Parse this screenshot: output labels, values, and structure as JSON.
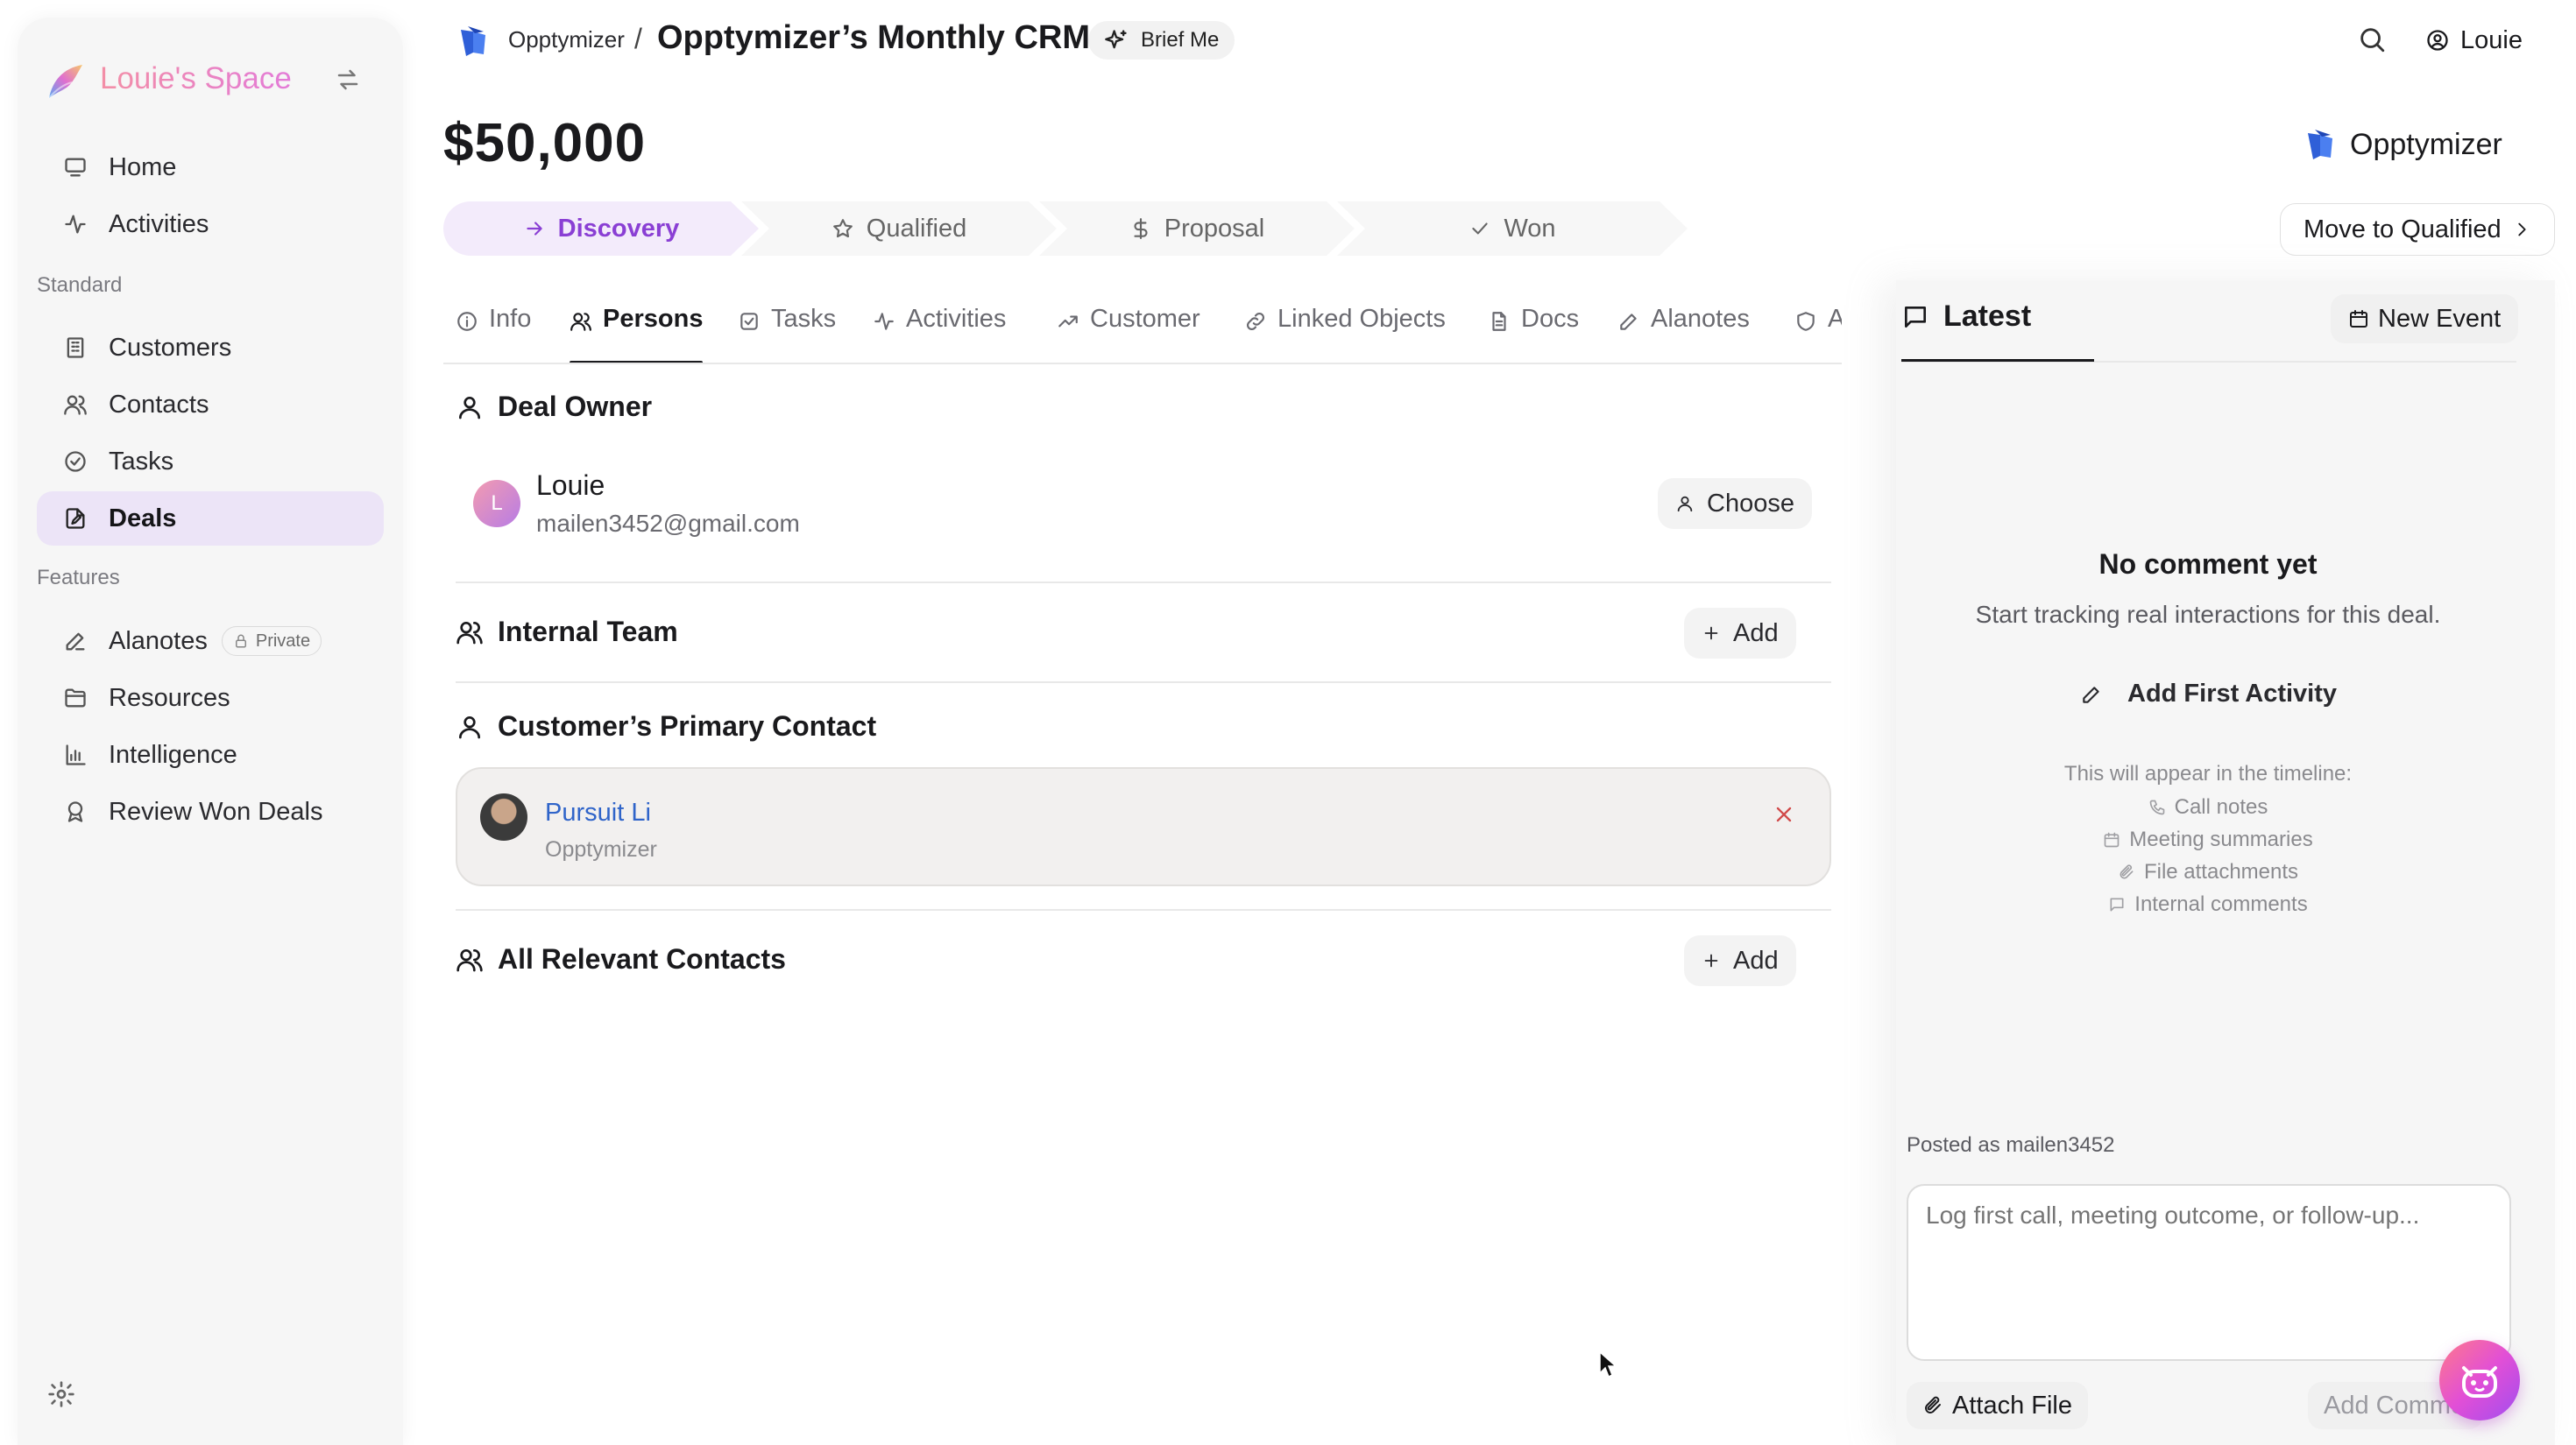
{
  "sidebar": {
    "workspace_name": "Louie's Space",
    "nav_main": [
      {
        "label": "Home",
        "icon": "monitor-icon"
      },
      {
        "label": "Activities",
        "icon": "activity-icon"
      }
    ],
    "standard_label": "Standard",
    "nav_standard": [
      {
        "label": "Customers",
        "icon": "building-icon"
      },
      {
        "label": "Contacts",
        "icon": "users-icon"
      },
      {
        "label": "Tasks",
        "icon": "check-circle-icon"
      },
      {
        "label": "Deals",
        "icon": "document-edit-icon",
        "active": true
      }
    ],
    "features_label": "Features",
    "nav_features": [
      {
        "label": "Alanotes",
        "icon": "pen-icon",
        "badge": "Private"
      },
      {
        "label": "Resources",
        "icon": "folder-icon"
      },
      {
        "label": "Intelligence",
        "icon": "bar-chart-icon"
      },
      {
        "label": "Review Won Deals",
        "icon": "award-icon"
      }
    ]
  },
  "topbar": {
    "org": "Opptymizer",
    "separator": "/",
    "title": "Opptymizer’s Monthly CRM",
    "brief_label": "Brief Me",
    "user_name": "Louie"
  },
  "deal": {
    "amount": "$50,000",
    "company": "Opptymizer",
    "stages": [
      {
        "label": "Discovery",
        "icon": "arrow-right-icon",
        "state": "current"
      },
      {
        "label": "Qualified",
        "icon": "star-icon",
        "state": "next"
      },
      {
        "label": "Proposal",
        "icon": "dollar-icon",
        "state": "next"
      },
      {
        "label": "Won",
        "icon": "check-icon",
        "state": "next"
      }
    ],
    "move_label": "Move to Qualified"
  },
  "tabs": [
    {
      "label": "Info",
      "icon": "info-icon"
    },
    {
      "label": "Persons",
      "icon": "users-icon",
      "active": true
    },
    {
      "label": "Tasks",
      "icon": "checkbox-icon"
    },
    {
      "label": "Activities",
      "icon": "activity-icon"
    },
    {
      "label": "Customer",
      "icon": "trending-up-icon"
    },
    {
      "label": "Linked Objects",
      "icon": "link-icon"
    },
    {
      "label": "Docs",
      "icon": "file-icon"
    },
    {
      "label": "Alanotes",
      "icon": "pen-icon"
    },
    {
      "label": "A",
      "icon": "shield-icon"
    }
  ],
  "persons": {
    "deal_owner_title": "Deal Owner",
    "owner": {
      "initial": "L",
      "name": "Louie",
      "email": "mailen3452@gmail.com"
    },
    "choose_label": "Choose",
    "internal_team_title": "Internal Team",
    "add_label": "Add",
    "primary_contact_title": "Customer’s Primary Contact",
    "primary_contact": {
      "name": "Pursuit Li",
      "org": "Opptymizer"
    },
    "all_contacts_title": "All Relevant Contacts"
  },
  "panel": {
    "latest_label": "Latest",
    "new_event_label": "New Event",
    "empty_title": "No comment yet",
    "empty_sub": "Start tracking real interactions for this deal.",
    "add_first_label": "Add First Activity",
    "timeline_head": "This will appear in the timeline:",
    "timeline_items": [
      {
        "label": "Call notes",
        "icon": "phone-icon"
      },
      {
        "label": "Meeting summaries",
        "icon": "calendar-icon"
      },
      {
        "label": "File attachments",
        "icon": "paperclip-icon"
      },
      {
        "label": "Internal comments",
        "icon": "message-icon"
      }
    ],
    "posted_as": "Posted as mailen3452",
    "comment_placeholder": "Log first call, meeting outcome, or follow-up...",
    "attach_label": "Attach File",
    "add_comment_label": "Add Comment"
  },
  "colors": {
    "accent_purple": "#8a3fd4",
    "active_nav_bg": "#ece4f7",
    "link_blue": "#2f64c9",
    "remove_red": "#d14a4a",
    "brand_gradient_start": "#f38fa6",
    "brand_gradient_end": "#e37bd8"
  }
}
